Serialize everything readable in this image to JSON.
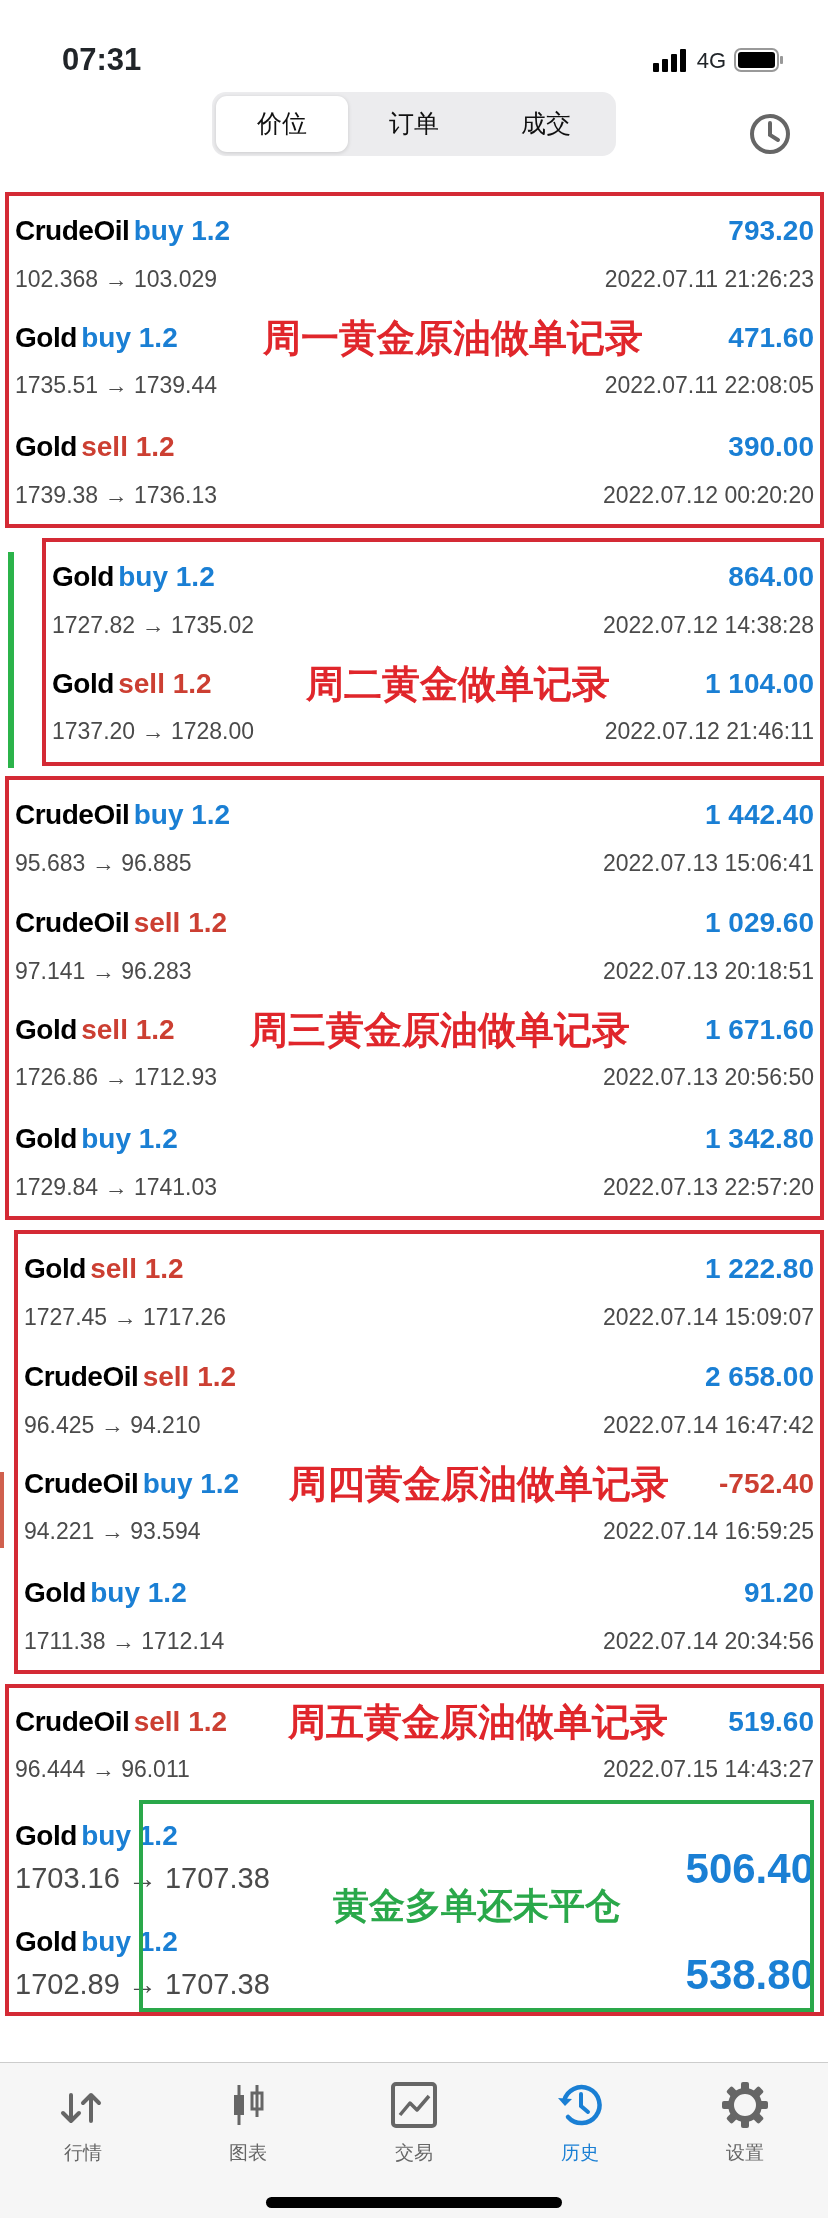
{
  "status_bar": {
    "time": "07:31",
    "network": "4G"
  },
  "segments": [
    {
      "label": "价位",
      "selected": true
    },
    {
      "label": "订单",
      "selected": false
    },
    {
      "label": "成交",
      "selected": false
    }
  ],
  "groups": [
    {
      "rows": [
        {
          "kind": "closed",
          "symbol": "CrudeOil",
          "side": "buy",
          "volume": "1.2",
          "profit": "793.20",
          "loss": false,
          "prices": "102.368 → 103.029",
          "time": "2022.07.11 21:26:23"
        },
        {
          "kind": "closed",
          "symbol": "Gold",
          "side": "buy",
          "volume": "1.2",
          "profit": "471.60",
          "loss": false,
          "prices": "1735.51 → 1739.44",
          "time": "2022.07.11 22:08:05",
          "note": "周一黄金原油做单记录"
        },
        {
          "kind": "closed",
          "symbol": "Gold",
          "side": "sell",
          "volume": "1.2",
          "profit": "390.00",
          "loss": false,
          "prices": "1739.38 → 1736.13",
          "time": "2022.07.12 00:20:20"
        }
      ]
    },
    {
      "indicator": {
        "color": "#2bb34a"
      },
      "rows": [
        {
          "kind": "closed",
          "symbol": "Gold",
          "side": "buy",
          "volume": "1.2",
          "profit": "864.00",
          "loss": false,
          "prices": "1727.82 → 1735.02",
          "time": "2022.07.12 14:38:28"
        },
        {
          "kind": "closed",
          "symbol": "Gold",
          "side": "sell",
          "volume": "1.2",
          "profit": "1 104.00",
          "loss": false,
          "prices": "1737.20 → 1728.00",
          "time": "2022.07.12 21:46:11",
          "note": "周二黄金做单记录"
        }
      ]
    },
    {
      "rows": [
        {
          "kind": "closed",
          "symbol": "CrudeOil",
          "side": "buy",
          "volume": "1.2",
          "profit": "1 442.40",
          "loss": false,
          "prices": "95.683 → 96.885",
          "time": "2022.07.13 15:06:41"
        },
        {
          "kind": "closed",
          "symbol": "CrudeOil",
          "side": "sell",
          "volume": "1.2",
          "profit": "1 029.60",
          "loss": false,
          "prices": "97.141 → 96.283",
          "time": "2022.07.13 20:18:51"
        },
        {
          "kind": "closed",
          "symbol": "Gold",
          "side": "sell",
          "volume": "1.2",
          "profit": "1 671.60",
          "loss": false,
          "prices": "1726.86 → 1712.93",
          "time": "2022.07.13 20:56:50",
          "note": "周三黄金原油做单记录"
        },
        {
          "kind": "closed",
          "symbol": "Gold",
          "side": "buy",
          "volume": "1.2",
          "profit": "1 342.80",
          "loss": false,
          "prices": "1729.84 → 1741.03",
          "time": "2022.07.13 22:57:20"
        }
      ]
    },
    {
      "rows": [
        {
          "kind": "closed",
          "symbol": "Gold",
          "side": "sell",
          "volume": "1.2",
          "profit": "1 222.80",
          "loss": false,
          "prices": "1727.45 → 1717.26",
          "time": "2022.07.14 15:09:07"
        },
        {
          "kind": "closed",
          "symbol": "CrudeOil",
          "side": "sell",
          "volume": "1.2",
          "profit": "2 658.00",
          "loss": false,
          "prices": "96.425 → 94.210",
          "time": "2022.07.14 16:47:42"
        },
        {
          "kind": "closed",
          "symbol": "CrudeOil",
          "side": "buy",
          "volume": "1.2",
          "profit": "-752.40",
          "loss": true,
          "prices": "94.221 → 93.594",
          "time": "2022.07.14 16:59:25",
          "note": "周四黄金原油做单记录",
          "indicator": {
            "color": "#d0604e"
          }
        },
        {
          "kind": "closed",
          "symbol": "Gold",
          "side": "buy",
          "volume": "1.2",
          "profit": "91.20",
          "loss": false,
          "prices": "1711.38 → 1712.14",
          "time": "2022.07.14 20:34:56"
        }
      ]
    },
    {
      "open_note": "黄金多单还未平仓",
      "rows": [
        {
          "kind": "closed",
          "symbol": "CrudeOil",
          "side": "sell",
          "volume": "1.2",
          "profit": "519.60",
          "loss": false,
          "prices": "96.444 → 96.011",
          "time": "2022.07.15 14:43:27",
          "note": "周五黄金原油做单记录"
        },
        {
          "kind": "open",
          "symbol": "Gold",
          "side": "buy",
          "volume": "1.2",
          "profit": "506.40",
          "loss": false,
          "prices": "1703.16 → 1707.38"
        },
        {
          "kind": "open",
          "symbol": "Gold",
          "side": "buy",
          "volume": "1.2",
          "profit": "538.80",
          "loss": false,
          "prices": "1702.89 → 1707.38"
        }
      ]
    }
  ],
  "tab_bar": [
    {
      "label": "行情",
      "selected": false
    },
    {
      "label": "图表",
      "selected": false
    },
    {
      "label": "交易",
      "selected": false
    },
    {
      "label": "历史",
      "selected": true
    },
    {
      "label": "设置",
      "selected": false
    }
  ]
}
